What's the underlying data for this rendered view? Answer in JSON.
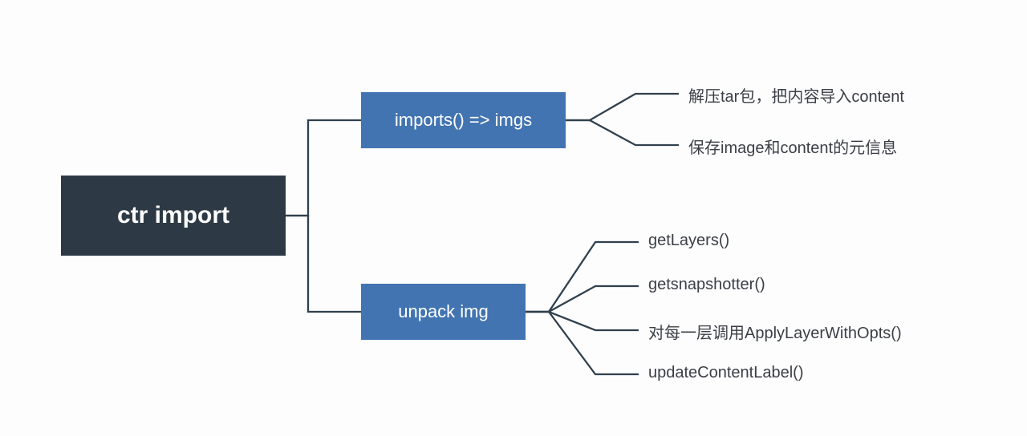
{
  "root": {
    "label": "ctr import"
  },
  "children": {
    "imports": {
      "label": "imports()  => imgs",
      "leaves": [
        "解压tar包，把内容导入content",
        "保存image和content的元信息"
      ]
    },
    "unpack": {
      "label": "unpack img",
      "leaves": [
        "getLayers()",
        "getsnapshotter()",
        "对每一层调用ApplyLayerWithOpts()",
        "updateContentLabel()"
      ]
    }
  }
}
